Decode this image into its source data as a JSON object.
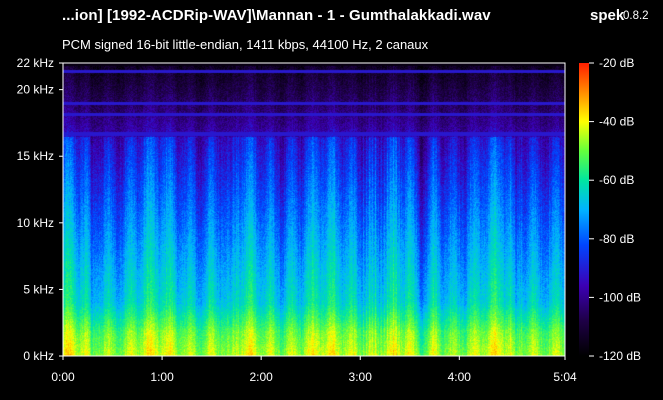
{
  "app": {
    "name": "spek",
    "version": "0.8.2"
  },
  "file": {
    "title": "...ion] [1992-ACDRip-WAV]\\Mannan - 1 - Gumthalakkadi.wav",
    "info": "PCM signed 16-bit little-endian, 1411 kbps, 44100 Hz, 2 canaux"
  },
  "colors": {
    "background": "#000000",
    "text": "#ffffff",
    "palette": [
      "#000000",
      "#1e0046",
      "#3c00b4",
      "#0046ff",
      "#00b4ff",
      "#00e6a0",
      "#64ff3c",
      "#ffff00",
      "#ff8c00",
      "#ff1e00"
    ]
  },
  "chart_data": {
    "type": "heatmap",
    "x_axis": {
      "ticks": [
        "0:00",
        "1:00",
        "2:00",
        "3:00",
        "4:00",
        "5:04"
      ],
      "range_seconds": [
        0,
        304
      ]
    },
    "y_axis": {
      "ticks": [
        "0 kHz",
        "5 kHz",
        "10 kHz",
        "15 kHz",
        "20 kHz",
        "22 kHz"
      ],
      "range_khz": [
        0,
        22
      ]
    },
    "legend": {
      "ticks": [
        "-20 dB",
        "-40 dB",
        "-60 dB",
        "-80 dB",
        "-100 dB",
        "-120 dB"
      ],
      "range_db": [
        -120,
        -20
      ],
      "placement": "right"
    },
    "observations": {
      "lowpass_cutoff_khz": 16.5,
      "tone_lines_khz": [
        16.7,
        18.2,
        19.0,
        21.4
      ],
      "quiet_intervals_s": [
        [
          16,
          18
        ],
        [
          98,
          104
        ],
        [
          210,
          222
        ],
        [
          272,
          276
        ]
      ]
    }
  }
}
